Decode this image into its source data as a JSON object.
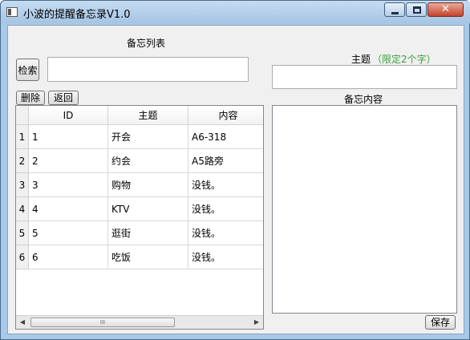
{
  "window": {
    "title": "小波的提醒备忘录V1.0"
  },
  "left": {
    "list_title": "备忘列表",
    "search_button": "检索",
    "search_value": "",
    "delete_button": "删除",
    "back_button": "返回",
    "table": {
      "columns": [
        "ID",
        "主题",
        "内容"
      ],
      "rows": [
        {
          "num": "1",
          "id": "1",
          "subject": "开会",
          "content": "A6-318"
        },
        {
          "num": "2",
          "id": "2",
          "subject": "约会",
          "content": "A5路旁"
        },
        {
          "num": "3",
          "id": "3",
          "subject": "购物",
          "content": "没钱。"
        },
        {
          "num": "4",
          "id": "4",
          "subject": "KTV",
          "content": "没钱。"
        },
        {
          "num": "5",
          "id": "5",
          "subject": "逛街",
          "content": "没钱。"
        },
        {
          "num": "6",
          "id": "6",
          "subject": "吃饭",
          "content": "没钱。"
        }
      ]
    },
    "scroll_grip": "III"
  },
  "right": {
    "subject_label": "主题",
    "subject_hint": "（限定2个字）",
    "subject_value": "",
    "content_label": "备忘内容",
    "content_value": "",
    "save_button": "保存"
  },
  "colors": {
    "hint_green": "#3ca03c",
    "title_bar": "#b3d1ee",
    "close_red": "#c5432a"
  },
  "icons": {
    "app": "app-icon",
    "minimize": "minimize-icon",
    "maximize": "maximize-icon",
    "close": "close-icon"
  }
}
